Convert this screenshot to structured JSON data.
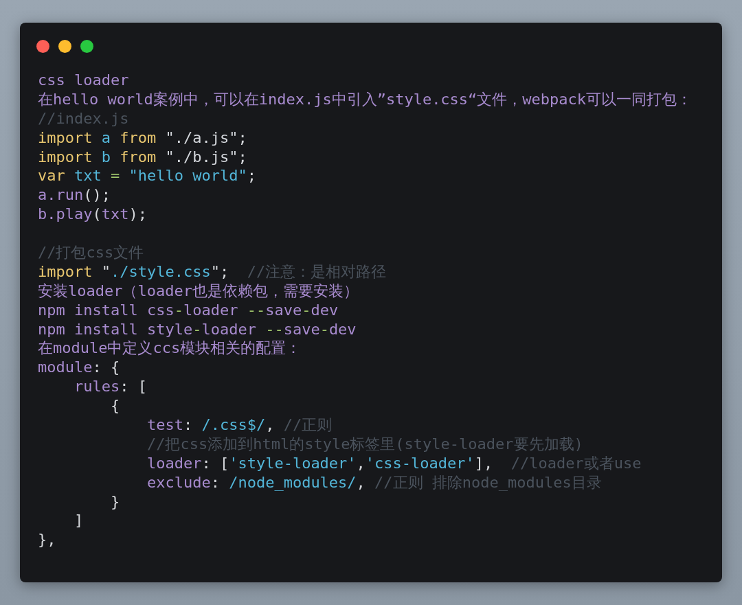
{
  "window": {
    "buttons": [
      {
        "kind": "close"
      },
      {
        "kind": "minimize"
      },
      {
        "kind": "zoom"
      }
    ]
  },
  "code": [
    {
      "kind": "code",
      "tokens": [
        {
          "kind": "text",
          "text": "css loader"
        }
      ]
    },
    {
      "kind": "code",
      "tokens": [
        {
          "kind": "text",
          "text": "在hello world案例中，可以在index.js中引入”style.css“文件，webpack可以一同打包："
        }
      ]
    },
    {
      "kind": "code",
      "tokens": [
        {
          "kind": "comment",
          "text": "//index.js"
        }
      ]
    },
    {
      "kind": "code",
      "tokens": [
        {
          "kind": "keyword",
          "text": "import"
        },
        {
          "kind": "name",
          "text": " a "
        },
        {
          "kind": "keyword",
          "text": "from"
        },
        {
          "kind": "string",
          "text": " \"./a.js\""
        },
        {
          "kind": "punct",
          "text": ";"
        }
      ]
    },
    {
      "kind": "code",
      "tokens": [
        {
          "kind": "keyword",
          "text": "import"
        },
        {
          "kind": "name",
          "text": " b "
        },
        {
          "kind": "keyword",
          "text": "from"
        },
        {
          "kind": "string",
          "text": " \"./b.js\""
        },
        {
          "kind": "punct",
          "text": ";"
        }
      ]
    },
    {
      "kind": "code",
      "tokens": [
        {
          "kind": "keyword",
          "text": "var"
        },
        {
          "kind": "name",
          "text": " txt "
        },
        {
          "kind": "operator",
          "text": "="
        },
        {
          "kind": "name",
          "text": " \"hello world\""
        },
        {
          "kind": "punct",
          "text": ";"
        }
      ]
    },
    {
      "kind": "code",
      "tokens": [
        {
          "kind": "text",
          "text": "a.run"
        },
        {
          "kind": "punct",
          "text": "();"
        }
      ]
    },
    {
      "kind": "code",
      "tokens": [
        {
          "kind": "text",
          "text": "b.play"
        },
        {
          "kind": "punct",
          "text": "("
        },
        {
          "kind": "text",
          "text": "txt"
        },
        {
          "kind": "punct",
          "text": ");"
        }
      ]
    },
    {
      "kind": "blank"
    },
    {
      "kind": "code",
      "tokens": [
        {
          "kind": "comment",
          "text": "//打包css文件"
        }
      ]
    },
    {
      "kind": "code",
      "tokens": [
        {
          "kind": "keyword",
          "text": "import"
        },
        {
          "kind": "punct",
          "text": " \""
        },
        {
          "kind": "name",
          "text": "./style.css"
        },
        {
          "kind": "punct",
          "text": "\";"
        },
        {
          "kind": "comment",
          "text": "  //注意：是相对路径"
        }
      ]
    },
    {
      "kind": "code",
      "tokens": [
        {
          "kind": "text",
          "text": "安装loader（loader也是依赖包，需要安装）"
        }
      ]
    },
    {
      "kind": "code",
      "tokens": [
        {
          "kind": "text",
          "text": "npm install css"
        },
        {
          "kind": "operator",
          "text": "-"
        },
        {
          "kind": "text",
          "text": "loader "
        },
        {
          "kind": "operator",
          "text": "--"
        },
        {
          "kind": "text",
          "text": "save"
        },
        {
          "kind": "operator",
          "text": "-"
        },
        {
          "kind": "text",
          "text": "dev"
        }
      ]
    },
    {
      "kind": "code",
      "tokens": [
        {
          "kind": "text",
          "text": "npm install style"
        },
        {
          "kind": "operator",
          "text": "-"
        },
        {
          "kind": "text",
          "text": "loader "
        },
        {
          "kind": "operator",
          "text": "--"
        },
        {
          "kind": "text",
          "text": "save"
        },
        {
          "kind": "operator",
          "text": "-"
        },
        {
          "kind": "text",
          "text": "dev"
        }
      ]
    },
    {
      "kind": "code",
      "tokens": [
        {
          "kind": "text",
          "text": "在module中定义ccs模块相关的配置："
        }
      ]
    },
    {
      "kind": "code",
      "tokens": [
        {
          "kind": "text",
          "text": "module"
        },
        {
          "kind": "punct",
          "text": ": {"
        }
      ]
    },
    {
      "kind": "code",
      "tokens": [
        {
          "kind": "text",
          "text": "    rules"
        },
        {
          "kind": "punct",
          "text": ": ["
        }
      ]
    },
    {
      "kind": "code",
      "tokens": [
        {
          "kind": "punct",
          "text": "        {"
        }
      ]
    },
    {
      "kind": "code",
      "tokens": [
        {
          "kind": "text",
          "text": "            test"
        },
        {
          "kind": "punct",
          "text": ": "
        },
        {
          "kind": "name",
          "text": "/.css$/"
        },
        {
          "kind": "punct",
          "text": ", "
        },
        {
          "kind": "comment",
          "text": "//正则"
        }
      ]
    },
    {
      "kind": "code",
      "tokens": [
        {
          "kind": "comment",
          "text": "            //把css添加到html的style标签里(style-loader要先加载)"
        }
      ]
    },
    {
      "kind": "code",
      "tokens": [
        {
          "kind": "text",
          "text": "            loader"
        },
        {
          "kind": "punct",
          "text": ": ["
        },
        {
          "kind": "name",
          "text": "'style-loader'"
        },
        {
          "kind": "punct",
          "text": ","
        },
        {
          "kind": "name",
          "text": "'css-loader'"
        },
        {
          "kind": "punct",
          "text": "],  "
        },
        {
          "kind": "comment",
          "text": "//loader或者use"
        }
      ]
    },
    {
      "kind": "code",
      "tokens": [
        {
          "kind": "text",
          "text": "            exclude"
        },
        {
          "kind": "punct",
          "text": ": "
        },
        {
          "kind": "name",
          "text": "/node_modules/"
        },
        {
          "kind": "punct",
          "text": ", "
        },
        {
          "kind": "comment",
          "text": "//正则 排除node_modules目录"
        }
      ]
    },
    {
      "kind": "code",
      "tokens": [
        {
          "kind": "punct",
          "text": "        }"
        }
      ]
    },
    {
      "kind": "code",
      "tokens": [
        {
          "kind": "punct",
          "text": "    ]"
        }
      ]
    },
    {
      "kind": "code",
      "tokens": [
        {
          "kind": "punct",
          "text": "},"
        }
      ]
    }
  ]
}
